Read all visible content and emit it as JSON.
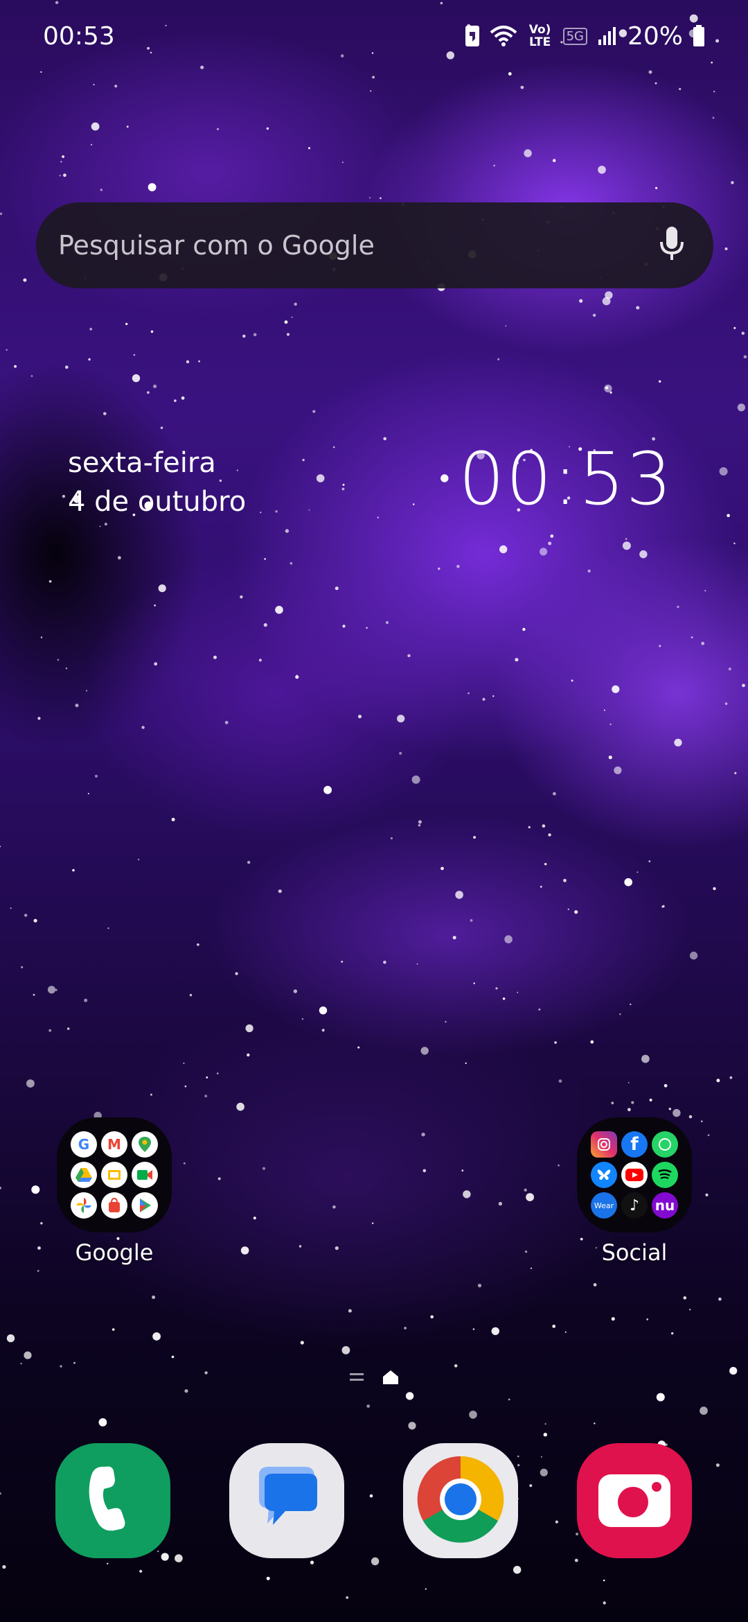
{
  "status_bar": {
    "time": "00:53",
    "network_label": "Vo) LTE",
    "network_type": "5G",
    "battery": "20%",
    "icons": [
      "sim-icon",
      "wifi-icon",
      "volte-icon",
      "5g-icon",
      "signal-icon",
      "battery-icon"
    ]
  },
  "search": {
    "placeholder": "Pesquisar com o Google",
    "icon": "mic-icon"
  },
  "date_widget": {
    "weekday": "sexta-feira",
    "date": "4 de outubro"
  },
  "clock_widget": {
    "time": "00:53"
  },
  "folders": [
    {
      "label": "Google",
      "apps": [
        "google-icon",
        "gmail-icon",
        "maps-icon",
        "drive-icon",
        "slides-icon",
        "meet-icon",
        "photos-icon",
        "shopping-icon",
        "play-store-icon"
      ]
    },
    {
      "label": "Social",
      "apps": [
        "instagram-icon",
        "facebook-icon",
        "whatsapp-icon",
        "bluesky-icon",
        "youtube-icon",
        "spotify-icon",
        "wear-icon",
        "tiktok-icon",
        "nubank-icon"
      ],
      "mini_labels": {
        "wear": "Wear",
        "nubank": "nu"
      }
    }
  ],
  "dock": {
    "apps": [
      "phone-icon",
      "messages-icon",
      "chrome-icon",
      "camera-icon"
    ]
  },
  "colors": {
    "phone": "#0f9e5f",
    "messages": "#e8e8ec",
    "chrome": "#e9e9ee",
    "camera": "#e0124d",
    "search_bar": "#1c1822"
  }
}
